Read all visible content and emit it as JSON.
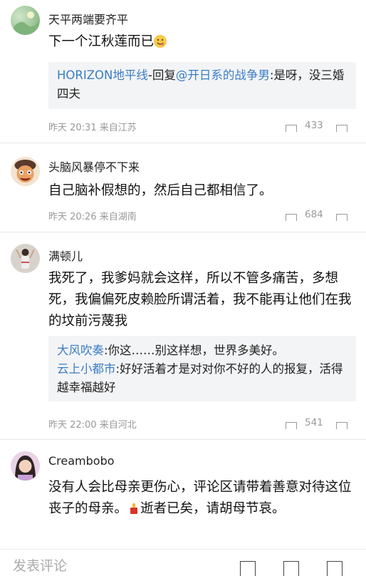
{
  "comments": [
    {
      "username": "天平两端要齐平",
      "text": "下一个江秋莲而已",
      "emoji": "yum-face-emoji",
      "replies": [
        {
          "author": "HORIZON地平线",
          "middle": "-回复",
          "mention": "@开日系的战争男",
          "text": ":是呀，没三婚四夫"
        }
      ],
      "time": "昨天 20:31",
      "location": "来自江苏",
      "likes": "433"
    },
    {
      "username": "头脑风暴停不下来",
      "text": "自己脑补假想的，然后自己都相信了。",
      "time": "昨天 20:26",
      "location": "来自湖南",
      "likes": "684"
    },
    {
      "username": "满顿儿",
      "text": "我死了，我爹妈就会这样，所以不管多痛苦，多想死，我偏偏死皮赖脸所谓活着，我不能再让他们在我的坟前污蔑我",
      "replies": [
        {
          "author": "大风吹奏",
          "text": ":你这……别这样想，世界多美好。"
        },
        {
          "author": "云上小都市",
          "text": ":好好活着才是对对你不好的人的报复，活得越幸福越好"
        }
      ],
      "time": "昨天 22:00",
      "location": "来自河北",
      "likes": "541"
    },
    {
      "username": "Creambobo",
      "text_before": "没有人会比母亲更伤心，评论区请带着善意对待这位丧子的母亲。",
      "emoji": "candle-emoji",
      "text_after": "逝者已矣，请胡母节哀。"
    }
  ],
  "footer": {
    "placeholder": "发表评论"
  },
  "colors": {
    "link": "#3a7dc3",
    "meta": "#999999",
    "quote_bg": "#f3f4f6"
  }
}
